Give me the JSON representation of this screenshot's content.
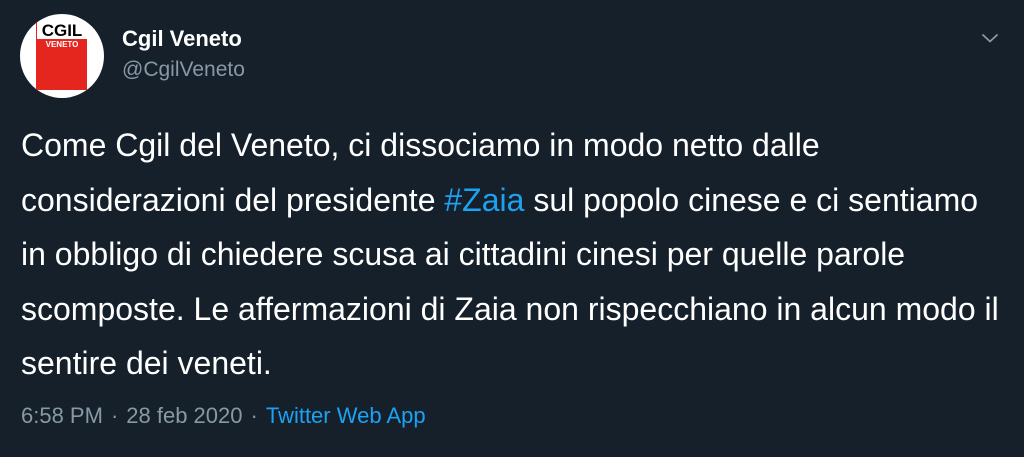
{
  "author": {
    "display_name": "Cgil Veneto",
    "handle": "@CgilVeneto",
    "avatar_logo_text": "CGIL",
    "avatar_logo_subtext": "VENETO"
  },
  "tweet": {
    "text_before_hashtag": "Come Cgil del Veneto, ci dissociamo in modo netto dalle considerazioni del presidente ",
    "hashtag": "#Zaia",
    "text_after_hashtag": " sul popolo cinese e ci sentiamo in obbligo di chiedere scusa ai cittadini cinesi per quelle parole scomposte. Le affermazioni di Zaia non rispecchiano in alcun modo il sentire dei veneti."
  },
  "meta": {
    "time": "6:58 PM",
    "separator_1": "·",
    "date": "28 feb 2020",
    "separator_2": "·",
    "source": "Twitter Web App"
  },
  "icons": {
    "menu": "chevron-down-icon"
  },
  "colors": {
    "background": "#15202b",
    "text": "#ffffff",
    "secondary": "#8899a6",
    "link": "#1da1f2",
    "logo_red": "#e4261f"
  }
}
